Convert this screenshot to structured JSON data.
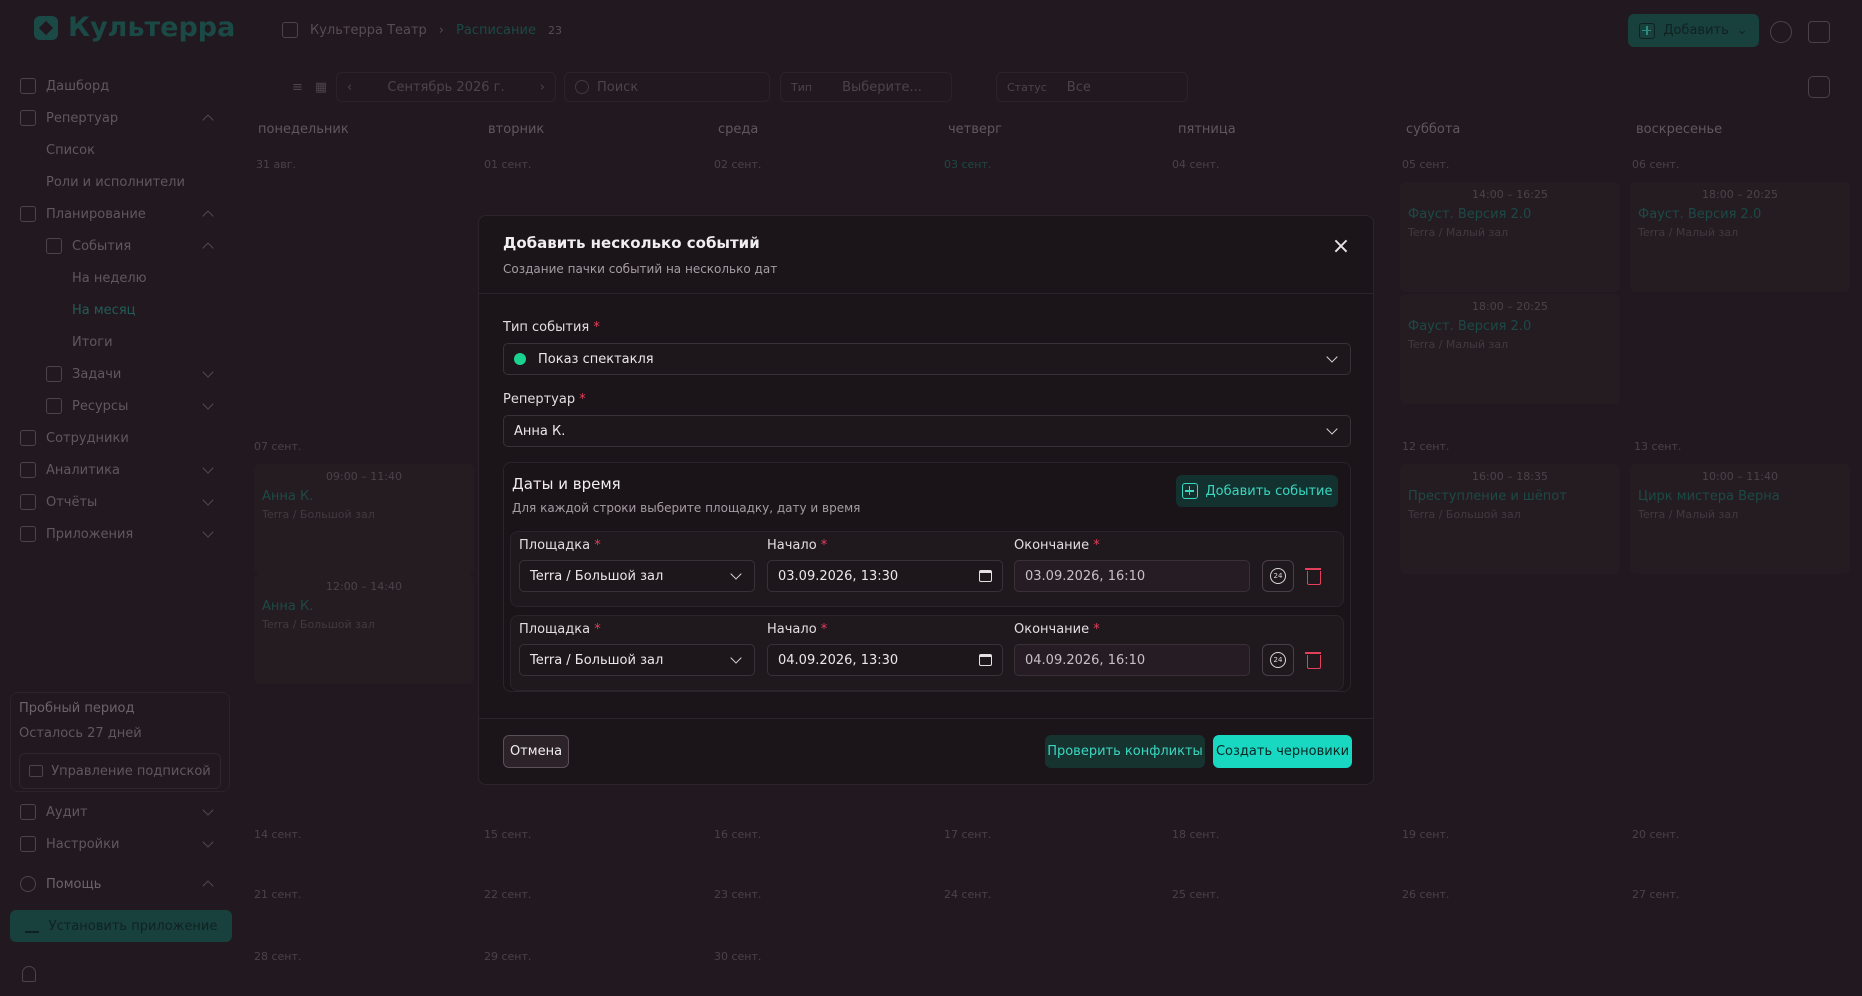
{
  "app": {
    "logo": "Культерра"
  },
  "breadcrumb": {
    "org": "Культерра Театр",
    "page": "Расписание",
    "count": "23"
  },
  "topbar": {
    "add_label": "Добавить"
  },
  "toolbar": {
    "month": "Сентябрь 2026 г.",
    "search_placeholder": "Поиск",
    "type_label": "Тип",
    "type_placeholder": "Выберите...",
    "status_label": "Статус",
    "status_value": "Все"
  },
  "sidebar": {
    "items": [
      {
        "label": "Дашборд"
      },
      {
        "label": "Репертуар"
      },
      {
        "label": "Список"
      },
      {
        "label": "Роли и исполнители"
      },
      {
        "label": "Планирование"
      },
      {
        "label": "События"
      },
      {
        "label": "На неделю"
      },
      {
        "label": "На месяц"
      },
      {
        "label": "Итоги"
      },
      {
        "label": "Задачи"
      },
      {
        "label": "Ресурсы"
      },
      {
        "label": "Сотрудники"
      },
      {
        "label": "Аналитика"
      },
      {
        "label": "Отчёты"
      },
      {
        "label": "Приложения"
      }
    ],
    "trial_title": "Пробный период",
    "trial_days": "Осталось 27 дней",
    "subscription": "Управление подпиской",
    "audit": "Аудит",
    "settings": "Настройки",
    "help": "Помощь",
    "install": "Установить приложение"
  },
  "calendar": {
    "days": [
      "понедельник",
      "вторник",
      "среда",
      "четверг",
      "пятница",
      "суббота",
      "воскресенье"
    ],
    "dates": [
      "31 авг.",
      "01 сент.",
      "02 сент.",
      "03 сент.",
      "04 сент.",
      "05 сент.",
      "06 сент.",
      "07 сент.",
      "12 сент.",
      "13 сент.",
      "14 сент.",
      "15 сент.",
      "16 сент.",
      "17 сент.",
      "18 сент.",
      "19 сент.",
      "20 сент.",
      "21 сент.",
      "22 сент.",
      "23 сент.",
      "24 сент.",
      "25 сент.",
      "26 сент.",
      "27 сент.",
      "28 сент.",
      "29 сент.",
      "30 сент."
    ],
    "events": [
      {
        "time": "14:00 – 16:25",
        "name": "Фауст. Версия 2.0",
        "place": "Terra / Малый зал"
      },
      {
        "time": "18:00 – 20:25",
        "name": "Фауст. Версия 2.0",
        "place": "Terra / Малый зал"
      },
      {
        "time": "18:00 – 20:25",
        "name": "Фауст. Версия 2.0",
        "place": "Terra / Малый зал"
      },
      {
        "time": "09:00 – 11:40",
        "name": "Анна К.",
        "place": "Terra / Большой зал"
      },
      {
        "time": "12:00 – 14:40",
        "name": "Анна К.",
        "place": "Terra / Большой зал"
      },
      {
        "time": "16:00 – 18:35",
        "name": "Преступление и шёпот",
        "place": "Terra / Большой зал"
      },
      {
        "time": "10:00 – 11:40",
        "name": "Цирк мистера Верна",
        "place": "Terra / Малый зал"
      }
    ]
  },
  "modal": {
    "title": "Добавить несколько событий",
    "subtitle": "Создание пачки событий на несколько дат",
    "event_type_label": "Тип события",
    "event_type_value": "Показ спектакля",
    "event_type_color": "#19d38f",
    "repertoire_label": "Репертуар",
    "repertoire_value": "Анна К.",
    "dates_title": "Даты и время",
    "dates_subtitle": "Для каждой строки выберите площадку, дату и время",
    "add_event_label": "Добавить событие",
    "rows": [
      {
        "venue_label": "Площадка",
        "venue": "Terra / Большой зал",
        "start_label": "Начало",
        "start": "03.09.2026, 13:30",
        "end_label": "Окончание",
        "end": "03.09.2026, 16:10"
      },
      {
        "venue_label": "Площадка",
        "venue": "Terra / Большой зал",
        "start_label": "Начало",
        "start": "04.09.2026, 13:30",
        "end_label": "Окончание",
        "end": "04.09.2026, 16:10"
      }
    ],
    "cancel_label": "Отмена",
    "check_label": "Проверить конфликты",
    "create_label": "Создать черновики"
  },
  "colors": {
    "accent": "#19d8c2",
    "danger": "#e2405a",
    "brand": "#1f6f66"
  }
}
